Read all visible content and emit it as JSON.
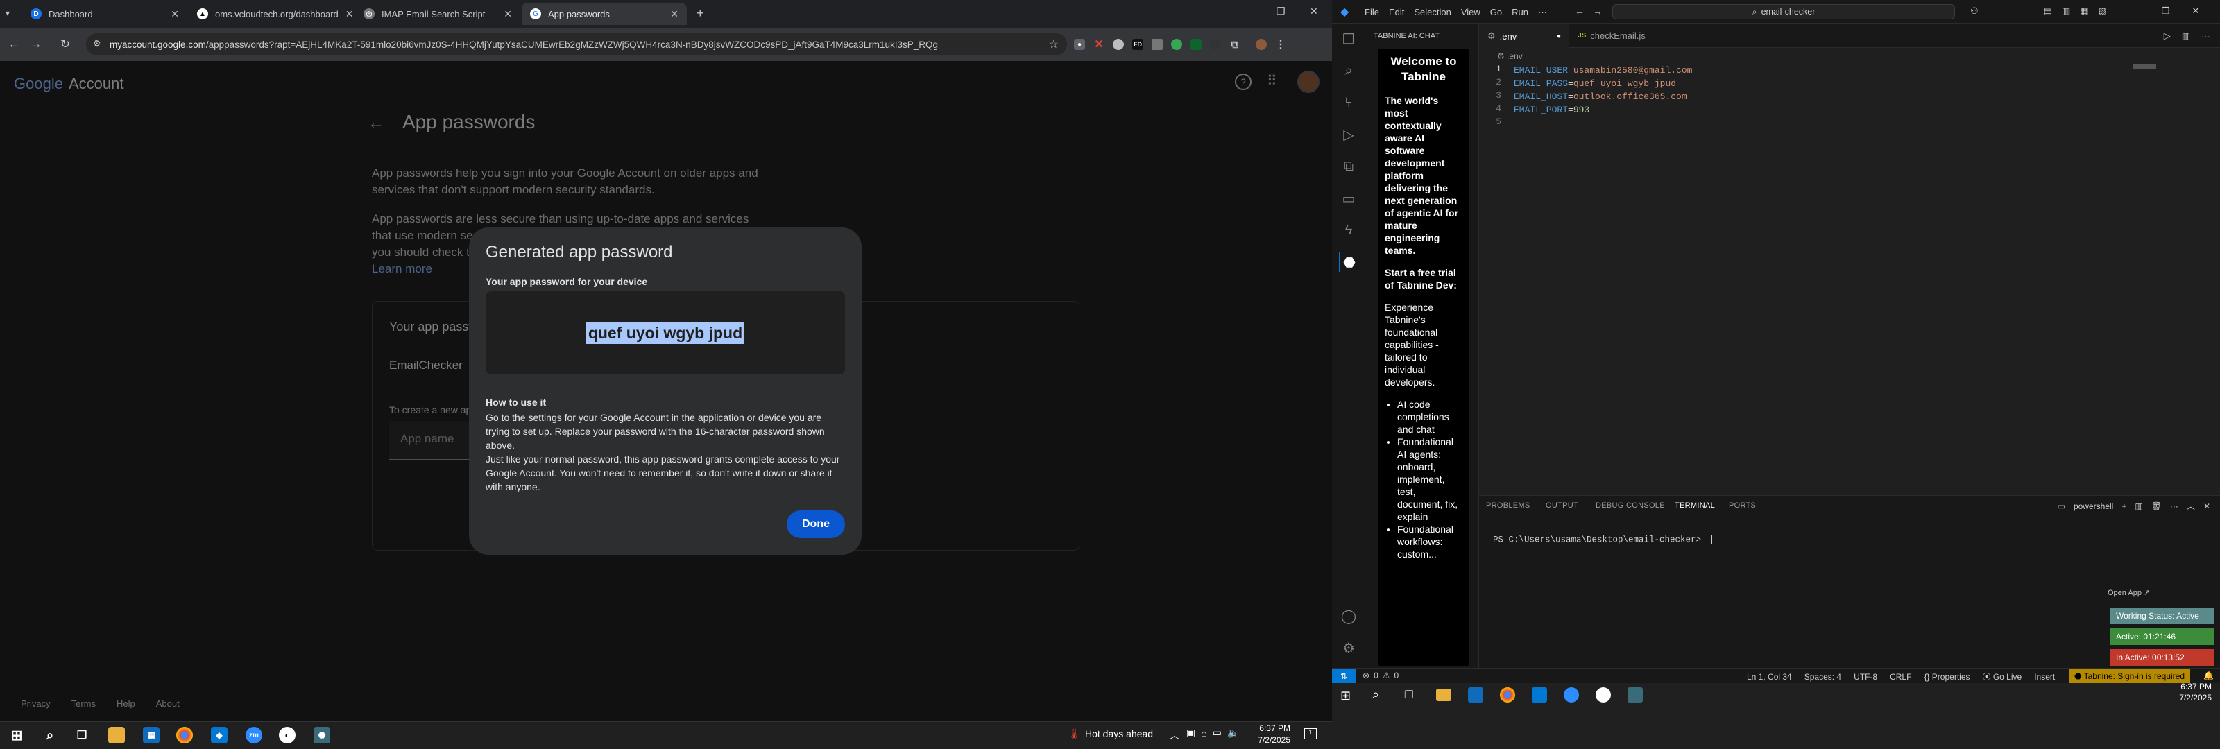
{
  "browser": {
    "tabs": [
      {
        "title": "Dashboard",
        "favicon": "D",
        "color": "#1a73e8"
      },
      {
        "title": "oms.vcloudtech.org/dashboard",
        "favicon": "▲",
        "color": "#555"
      },
      {
        "title": "IMAP Email Search Script",
        "favicon": "◎",
        "color": "#555"
      },
      {
        "title": "App passwords",
        "favicon": "G",
        "color": "#4285f4"
      }
    ],
    "url_host": "myaccount.google.com",
    "url_path": "/apppasswords?rapt=AEjHL4MKa2T-591mlo20bi6vmJz0S-4HHQMjYutpYsaCUMEwrEb2gMZzWZWj5QWH4rca3N-nBDy8jsvWZCODc9sPD_jAft9GaT4M9ca3Lrm1ukI3sP_RQg"
  },
  "google": {
    "logo_google": "Google",
    "logo_account": "Account",
    "page_title": "App passwords",
    "intro_1": "App passwords help you sign into your Google Account on older apps and services that don't support modern security standards.",
    "intro_2_line1": "App passwords are less secure than using up-to-date apps and services",
    "intro_2_line2": "that use modern sec",
    "intro_2_line3": "you should check to",
    "learn_more": "Learn more",
    "card_title": "Your app passw",
    "app_item": "EmailChecker",
    "create_hint": "To create a new ap",
    "app_name_placeholder": "App name",
    "footer": [
      "Privacy",
      "Terms",
      "Help",
      "About"
    ]
  },
  "modal": {
    "title": "Generated app password",
    "subtitle": "Your app password for your device",
    "password": "quef uyoi wgyb jpud",
    "howto_title": "How to use it",
    "howto_1": "Go to the settings for your Google Account in the application or device you are trying to set up. Replace your password with the 16-character password shown above.",
    "howto_2": "Just like your normal password, this app password grants complete access to your Google Account. You won't need to remember it, so don't write it down or share it with anyone.",
    "done": "Done"
  },
  "taskbar_left": {
    "weather": "Hot days ahead",
    "time": "6:37 PM",
    "date": "7/2/2025"
  },
  "vscode": {
    "menu": [
      "File",
      "Edit",
      "Selection",
      "View",
      "Go",
      "Run",
      "···"
    ],
    "search": "email-checker",
    "chat_header": "TABNINE AI: CHAT",
    "chat": {
      "welcome": "Welcome to Tabnine",
      "tagline": "The world's most contextually aware AI software development platform delivering the next generation of agentic AI for mature engineering teams.",
      "trial": "Start a free trial of Tabnine Dev:",
      "desc": "Experience Tabnine's foundational capabilities - tailored to individual developers.",
      "bullets": [
        "AI code completions and chat",
        "Foundational AI agents: onboard, implement, test, document, fix, explain",
        "Foundational workflows: custom..."
      ]
    },
    "tabs": [
      {
        "name": ".env",
        "active": true,
        "dirty": true
      },
      {
        "name": "checkEmail.js",
        "active": false
      }
    ],
    "breadcrumb": ".env",
    "code": [
      {
        "key": "EMAIL_USER",
        "val": "usamabin2580@gmail.com"
      },
      {
        "key": "EMAIL_PASS",
        "val": "quef uyoi wgyb jpud"
      },
      {
        "key": "EMAIL_HOST",
        "val": "outlook.office365.com"
      },
      {
        "key": "EMAIL_PORT",
        "val": "993"
      },
      {
        "key": "",
        "val": ""
      }
    ],
    "panel_tabs": [
      "PROBLEMS",
      "OUTPUT",
      "DEBUG CONSOLE",
      "TERMINAL",
      "PORTS"
    ],
    "active_panel": "TERMINAL",
    "shell": "powershell",
    "prompt": "PS C:\\Users\\usama\\Desktop\\email-checker> ",
    "status": {
      "errors": "0",
      "warnings": "0",
      "position": "Ln 1, Col 34",
      "spaces": "Spaces: 4",
      "encoding": "UTF-8",
      "eol": "CRLF",
      "language": "Properties",
      "golive": "Go Live",
      "mode": "Insert",
      "tabnine": "Tabnine: Sign-in is required"
    },
    "widget": {
      "open_app": "Open App ↗",
      "working": "Working Status: Active",
      "active": "Active: 01:21:46",
      "inactive": "In Active: 00:13:52"
    },
    "taskbar_time": "6:37 PM",
    "taskbar_date": "7/2/2025"
  }
}
